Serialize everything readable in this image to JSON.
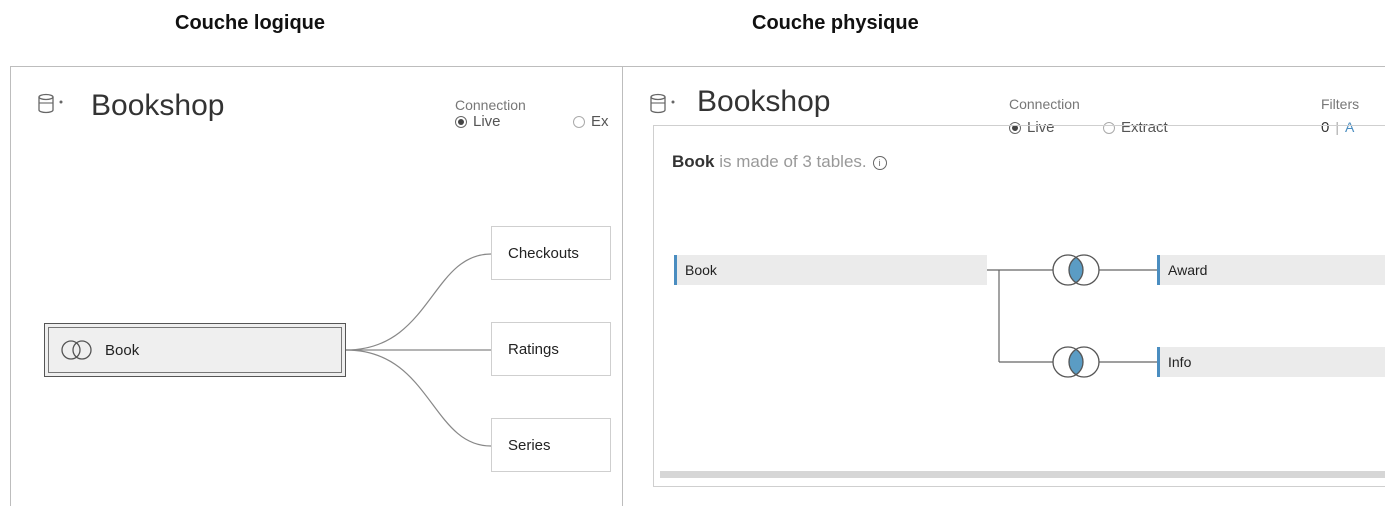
{
  "headings": {
    "left": "Couche logique",
    "right": "Couche physique"
  },
  "logical": {
    "datasource_title": "Bookshop",
    "connection_label": "Connection",
    "connection_options": [
      "Live",
      "Ex"
    ],
    "selected_connection": "Live",
    "root_table": "Book",
    "related_tables": [
      "Checkouts",
      "Ratings",
      "Series"
    ]
  },
  "physical": {
    "datasource_title": "Bookshop",
    "connection_label": "Connection",
    "connection_options": [
      "Live",
      "Extract"
    ],
    "selected_connection": "Live",
    "filters_label": "Filters",
    "filters_count": "0",
    "filters_link": "A",
    "made_of_table": "Book",
    "made_of_text": " is made of 3 tables.",
    "tables": [
      "Book",
      "Award",
      "Info"
    ]
  },
  "colors": {
    "accent": "#4a8dc0",
    "join_fill": "#5b9cc4",
    "panel_border": "#bdbdbd"
  }
}
